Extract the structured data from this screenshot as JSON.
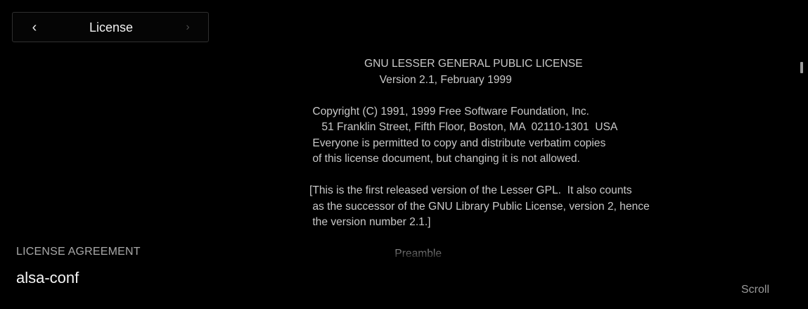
{
  "nav": {
    "prev_symbol": "‹",
    "title": "License",
    "next_symbol": "›"
  },
  "left_panel": {
    "section_label": "LICENSE AGREEMENT",
    "package_name": "alsa-conf"
  },
  "license": {
    "text": "                  GNU LESSER GENERAL PUBLIC LICENSE\n                       Version 2.1, February 1999\n\n Copyright (C) 1991, 1999 Free Software Foundation, Inc.\n    51 Franklin Street, Fifth Floor, Boston, MA  02110-1301  USA\n Everyone is permitted to copy and distribute verbatim copies\n of this license document, but changing it is not allowed.\n\n[This is the first released version of the Lesser GPL.  It also counts\n as the successor of the GNU Library Public License, version 2, hence\n the version number 2.1.]\n\n                            Preamble"
  },
  "footer": {
    "scroll_hint": "Scroll"
  },
  "colors": {
    "background": "#000000",
    "primary_text": "#f0f0f0",
    "secondary_text": "#a8a8a8",
    "license_text": "#c9c9c9"
  },
  "icons": {
    "prev": "chevron-left-icon",
    "next": "chevron-right-icon"
  }
}
